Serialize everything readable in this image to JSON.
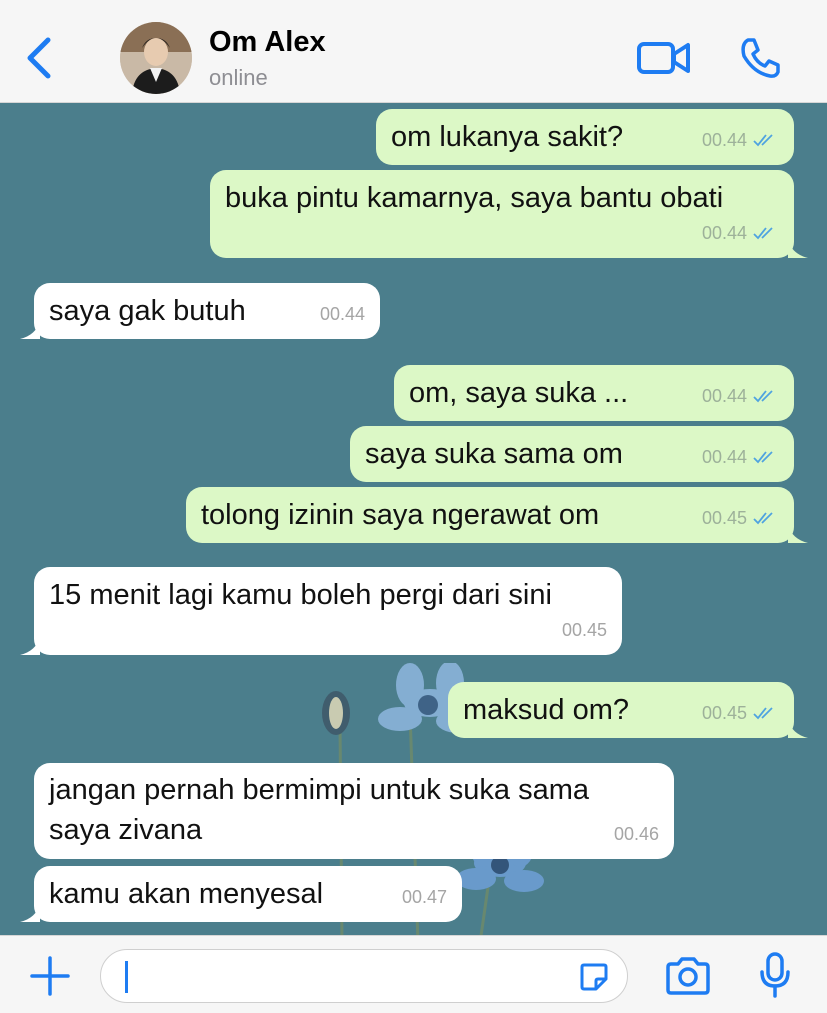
{
  "header": {
    "contact_name": "Om Alex",
    "status": "online",
    "back_icon": "chevron-left-icon",
    "video_icon": "video-camera-icon",
    "phone_icon": "phone-icon",
    "accent_color": "#1e7cf2"
  },
  "messages": [
    {
      "dir": "out",
      "text": "om lukanya sakit?",
      "time": "00.44"
    },
    {
      "dir": "out",
      "text": "buka pintu kamarnya, saya bantu obati",
      "time": "00.44"
    },
    {
      "dir": "in",
      "text": "saya gak butuh",
      "time": "00.44"
    },
    {
      "dir": "out",
      "text": "om, saya suka ...",
      "time": "00.44"
    },
    {
      "dir": "out",
      "text": "saya suka sama om",
      "time": "00.44"
    },
    {
      "dir": "out",
      "text": "tolong izinin saya ngerawat om",
      "time": "00.45"
    },
    {
      "dir": "in",
      "text": "15 menit lagi kamu boleh pergi dari sini",
      "time": "00.45"
    },
    {
      "dir": "out",
      "text": "maksud om?",
      "time": "00.45"
    },
    {
      "dir": "in",
      "text": "jangan pernah bermimpi untuk suka sama\nsaya zivana",
      "time": "00.46"
    },
    {
      "dir": "in",
      "text": "kamu akan menyesal",
      "time": "00.47"
    }
  ],
  "colors": {
    "outgoing_bubble": "#dcf8c6",
    "incoming_bubble": "#ffffff",
    "chat_background": "#4b7e8c",
    "read_ticks": "#4fa3e0"
  },
  "input": {
    "placeholder": "",
    "plus_icon": "plus-icon",
    "sticker_icon": "sticker-icon",
    "camera_icon": "camera-icon",
    "mic_icon": "microphone-icon"
  }
}
